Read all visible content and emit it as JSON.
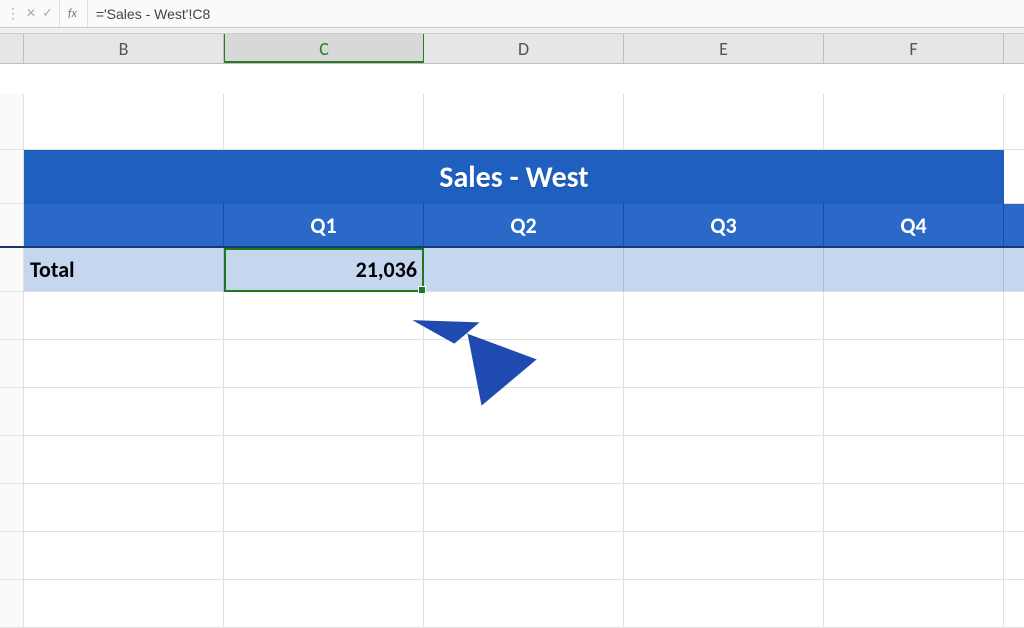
{
  "formula_bar": {
    "fx_label": "fx",
    "formula": "='Sales - West'!C8"
  },
  "columns": {
    "B": "B",
    "C": "C",
    "D": "D",
    "E": "E",
    "F": "F"
  },
  "table": {
    "title": "Sales - West",
    "headers": {
      "q1": "Q1",
      "q2": "Q2",
      "q3": "Q3",
      "q4": "Q4"
    },
    "row_label": "Total",
    "values": {
      "q1": "21,036",
      "q2": "",
      "q3": "",
      "q4": ""
    }
  }
}
